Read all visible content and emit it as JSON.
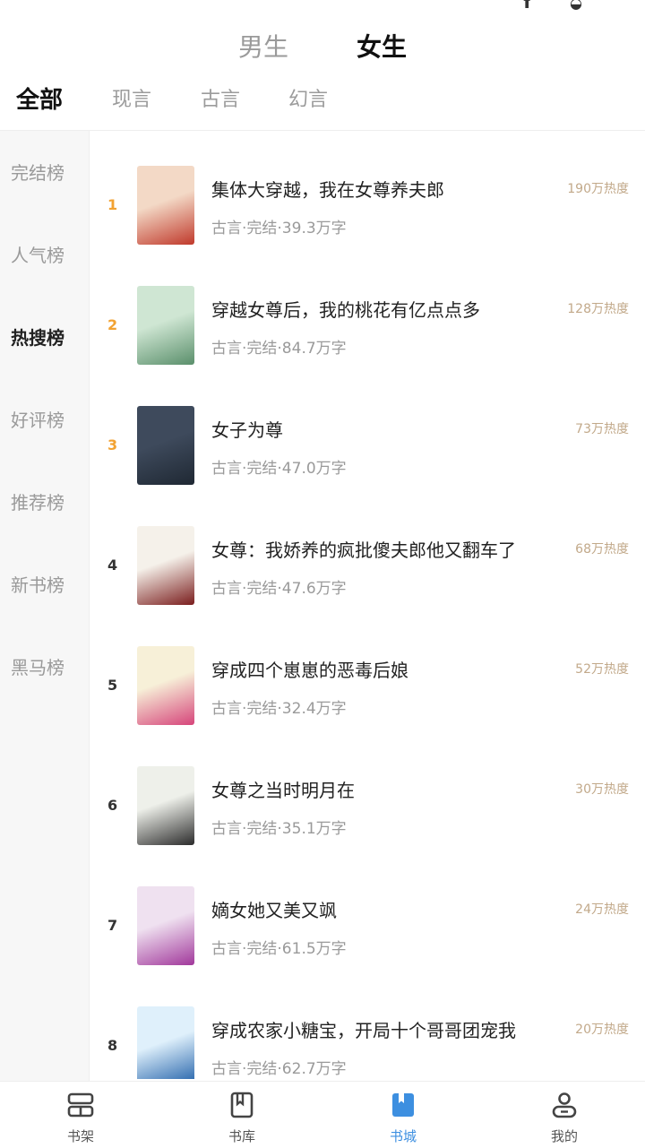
{
  "status_bar": {
    "icons_text": "⬆ ◒"
  },
  "gender_tabs": [
    {
      "label": "男生",
      "active": false
    },
    {
      "label": "女生",
      "active": true
    }
  ],
  "category_tabs": [
    {
      "label": "全部",
      "active": true
    },
    {
      "label": "现言",
      "active": false
    },
    {
      "label": "古言",
      "active": false
    },
    {
      "label": "幻言",
      "active": false
    }
  ],
  "side_menu": [
    {
      "label": "完结榜",
      "active": false
    },
    {
      "label": "人气榜",
      "active": false
    },
    {
      "label": "热搜榜",
      "active": true
    },
    {
      "label": "好评榜",
      "active": false
    },
    {
      "label": "推荐榜",
      "active": false
    },
    {
      "label": "新书榜",
      "active": false
    },
    {
      "label": "黑马榜",
      "active": false
    }
  ],
  "books": [
    {
      "rank": "1",
      "title": "集体大穿越，我在女尊养夫郎",
      "meta": "古言·完结·39.3万字",
      "heat": "190万热度",
      "cover_colors": [
        "#f3d9c6",
        "#c0392b"
      ]
    },
    {
      "rank": "2",
      "title": "穿越女尊后，我的桃花有亿点点多",
      "meta": "古言·完结·84.7万字",
      "heat": "128万热度",
      "cover_colors": [
        "#cfe6d3",
        "#5a8f6b"
      ]
    },
    {
      "rank": "3",
      "title": "女子为尊",
      "meta": "古言·完结·47.0万字",
      "heat": "73万热度",
      "cover_colors": [
        "#3e4a5c",
        "#1f2833"
      ]
    },
    {
      "rank": "4",
      "title": "女尊：我娇养的疯批傻夫郎他又翻车了",
      "meta": "古言·完结·47.6万字",
      "heat": "68万热度",
      "cover_colors": [
        "#f5f1ea",
        "#7a1d1d"
      ]
    },
    {
      "rank": "5",
      "title": "穿成四个崽崽的恶毒后娘",
      "meta": "古言·完结·32.4万字",
      "heat": "52万热度",
      "cover_colors": [
        "#f7f0d8",
        "#d6457a"
      ]
    },
    {
      "rank": "6",
      "title": "女尊之当时明月在",
      "meta": "古言·完结·35.1万字",
      "heat": "30万热度",
      "cover_colors": [
        "#eef0ea",
        "#2b2b2b"
      ]
    },
    {
      "rank": "7",
      "title": "嫡女她又美又飒",
      "meta": "古言·完结·61.5万字",
      "heat": "24万热度",
      "cover_colors": [
        "#efe1f0",
        "#a1389b"
      ]
    },
    {
      "rank": "8",
      "title": "穿成农家小糖宝，开局十个哥哥团宠我",
      "meta": "古言·完结·62.7万字",
      "heat": "20万热度",
      "cover_colors": [
        "#dff0fb",
        "#1f5fa8"
      ]
    }
  ],
  "bottom_nav": [
    {
      "label": "书架",
      "icon": "bookshelf-icon",
      "active": false
    },
    {
      "label": "书库",
      "icon": "library-icon",
      "active": false
    },
    {
      "label": "书城",
      "icon": "bookstore-icon",
      "active": true
    },
    {
      "label": "我的",
      "icon": "profile-icon",
      "active": false
    }
  ],
  "colors": {
    "accent": "#3d8fe0",
    "rank_top": "#f2a232",
    "heat": "#c2a98a"
  }
}
